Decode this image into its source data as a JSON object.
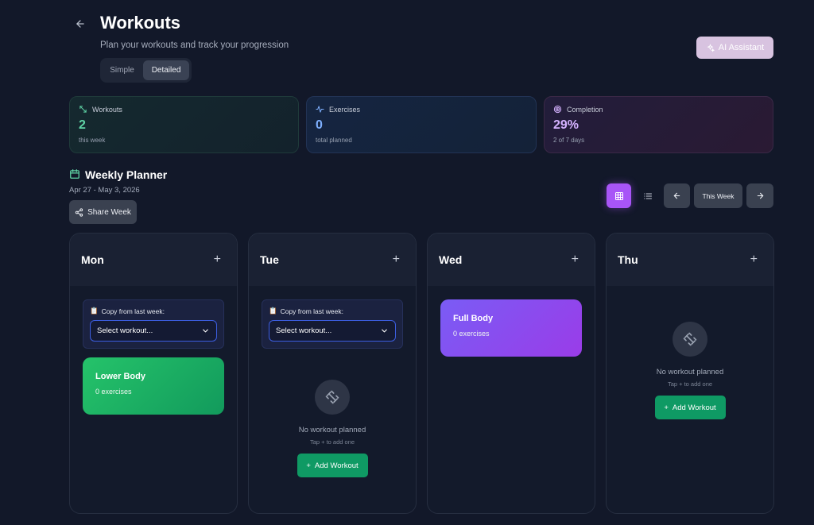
{
  "header": {
    "title": "Workouts",
    "subtitle": "Plan your workouts and track your progression",
    "modes": [
      "Simple",
      "Detailed"
    ],
    "selected_mode": "Detailed",
    "ai_button": "AI Assistant"
  },
  "stats": {
    "workouts": {
      "label": "Workouts",
      "value": "2",
      "sub": "this week",
      "color": "#5fd3a5"
    },
    "exercises": {
      "label": "Exercises",
      "value": "0",
      "sub": "total planned",
      "color": "#7fb0ff"
    },
    "completion": {
      "label": "Completion",
      "value": "29%",
      "sub": "2 of 7 days",
      "color": "#d5b2ff"
    }
  },
  "planner": {
    "title": "Weekly Planner",
    "date_range": "Apr 27 - May 3, 2026",
    "share_label": "Share Week",
    "this_week_label": "This Week"
  },
  "days": [
    {
      "name": "Mon",
      "copy_label": "Copy from last week:",
      "select_placeholder": "Select workout...",
      "workout": {
        "title": "Lower Body",
        "sub": "0 exercises"
      }
    },
    {
      "name": "Tue",
      "copy_label": "Copy from last week:",
      "select_placeholder": "Select workout...",
      "empty_title": "No workout planned",
      "empty_sub": "Tap + to add one",
      "add_label": "Add Workout"
    },
    {
      "name": "Wed",
      "workout": {
        "title": "Full Body",
        "sub": "0 exercises"
      }
    },
    {
      "name": "Thu",
      "empty_title": "No workout planned",
      "empty_sub": "Tap + to add one",
      "add_label": "Add Workout"
    }
  ]
}
